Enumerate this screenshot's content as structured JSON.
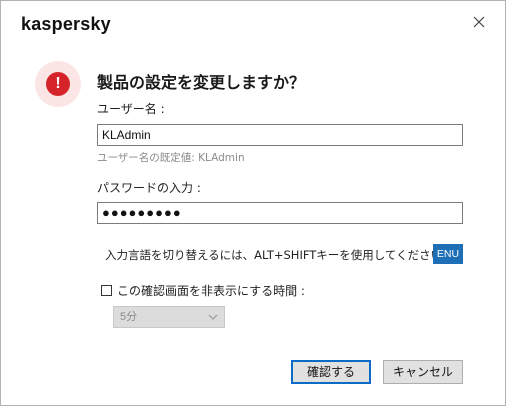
{
  "window": {
    "logo_text": "kaspersky"
  },
  "dialog": {
    "title": "製品の設定を変更しますか？",
    "username_label": "ユーザー名 :",
    "username_value": "KLAdmin",
    "username_hint": "ユーザー名の既定値: KLAdmin",
    "password_label": "パスワードの入力 :",
    "password_value": "●●●●●●●●●",
    "lang_instruction": "入力言語を切り替えるには、ALT+SHIFTキーを使用してください",
    "lang_badge": "ENU",
    "hide_checkbox_label": "この確認画面を非表示にする時間 :",
    "hide_checkbox_checked": false,
    "duration_select_value": "5分",
    "confirm_button": "確認する",
    "cancel_button": "キャンセル"
  },
  "colors": {
    "alert_red": "#d4242a",
    "alert_bg": "#fbe5e5",
    "lang_badge_bg": "#1f6fb7",
    "primary_button_border": "#0b6bc7"
  },
  "icons": {
    "close": "close-icon",
    "alert": "exclamation-icon",
    "dropdown": "chevron-down-icon"
  }
}
